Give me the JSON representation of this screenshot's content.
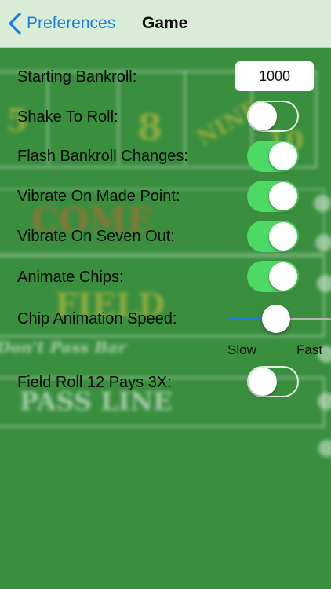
{
  "nav": {
    "back_label": "Preferences",
    "title": "Game"
  },
  "table_background": {
    "numbers": [
      "5",
      "8",
      "NINE",
      "10"
    ],
    "come": "COME",
    "field": "FIELD",
    "dont_pass_bar": "Don't Pass Bar",
    "pass_line": "PASS LINE"
  },
  "settings": {
    "starting_bankroll": {
      "label": "Starting Bankroll:",
      "value": "1000"
    },
    "shake_to_roll": {
      "label": "Shake To Roll:",
      "on": false
    },
    "flash_bankroll": {
      "label": "Flash Bankroll Changes:",
      "on": true
    },
    "vibrate_made_point": {
      "label": "Vibrate On Made Point:",
      "on": true
    },
    "vibrate_seven_out": {
      "label": "Vibrate On Seven Out:",
      "on": true
    },
    "animate_chips": {
      "label": "Animate Chips:",
      "on": true
    },
    "chip_animation_speed": {
      "label": "Chip Animation Speed:",
      "min_label": "Slow",
      "max_label": "Fast",
      "value_fraction": 0.45
    },
    "field_roll_12": {
      "label": "Field Roll 12 Pays 3X:",
      "on": false
    }
  },
  "colors": {
    "accent": "#1a7fe0",
    "toggle_on": "#4cd964",
    "felt": "#3a8f3f",
    "navbar": "#d8ecd6"
  }
}
